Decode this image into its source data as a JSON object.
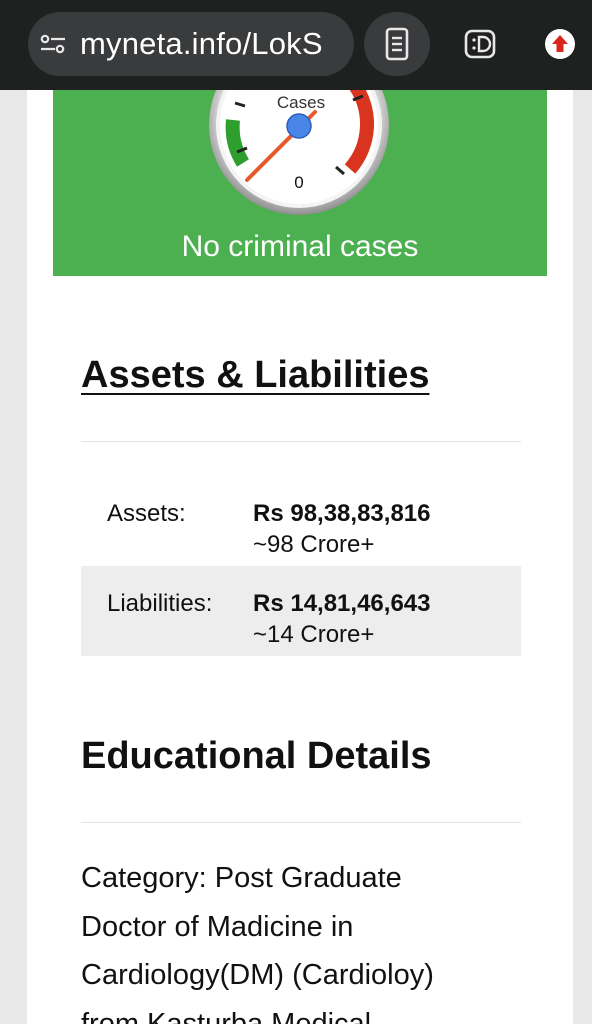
{
  "browser": {
    "url": "myneta.info/LokS",
    "icons": [
      "tune-icon",
      "reader-mode-icon",
      "extension-d-icon",
      "upload-icon"
    ]
  },
  "criminal": {
    "gauge_label": "Cases",
    "gauge_value": "0",
    "caption": "No criminal cases",
    "colors": {
      "panel": "#4caf50",
      "needle": "#e65a2c",
      "hub": "#4a86e8",
      "red_zone": "#d9341f",
      "green_zone": "#2e9e2e",
      "orange_zone": "#f39c12"
    }
  },
  "assets": {
    "title": "Assets & Liabilities",
    "rows": [
      {
        "label": "Assets:",
        "amount": "Rs 98,38,83,816",
        "approx": "~98 Crore+"
      },
      {
        "label": "Liabilities:",
        "amount": "Rs 14,81,46,643",
        "approx": "~14 Crore+"
      }
    ]
  },
  "education": {
    "title": "Educational Details",
    "lines": [
      "Category: Post Graduate",
      "Doctor of Madicine in",
      "Cardiology(DM) (Cardioloy)",
      "from Kasturba Medical"
    ]
  }
}
